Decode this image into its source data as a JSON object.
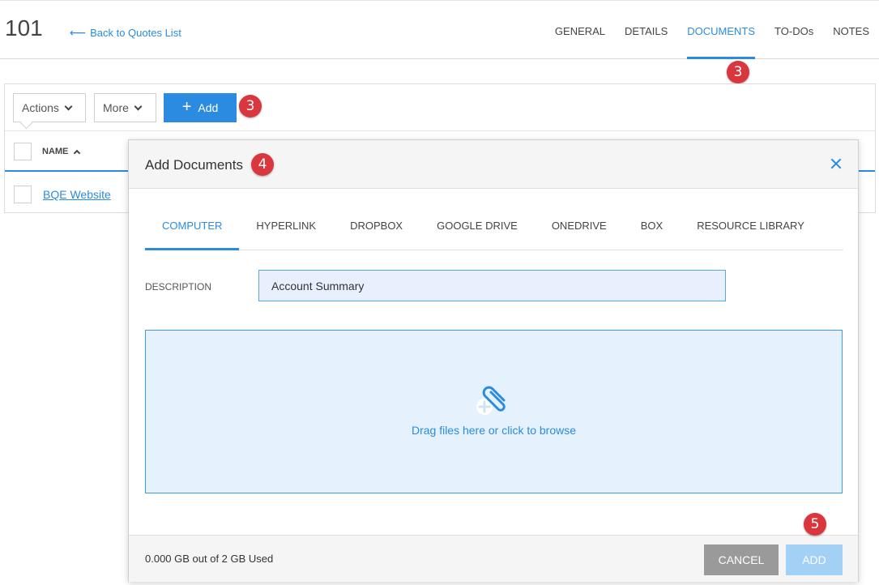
{
  "header": {
    "record_id": "101",
    "back_link": "Back to Quotes List",
    "tabs": [
      {
        "label": "GENERAL",
        "active": false
      },
      {
        "label": "DETAILS",
        "active": false
      },
      {
        "label": "DOCUMENTS",
        "active": true
      },
      {
        "label": "TO-DOs",
        "active": false
      },
      {
        "label": "NOTES",
        "active": false
      }
    ]
  },
  "badges": {
    "documents_tab": "3",
    "add_button": "3",
    "modal_title": "4",
    "modal_add": "5"
  },
  "toolbar": {
    "actions_label": "Actions",
    "more_label": "More",
    "add_label": "Add"
  },
  "grid": {
    "column_name": "NAME",
    "rows": [
      {
        "name": "BQE Website"
      }
    ]
  },
  "modal": {
    "title": "Add Documents",
    "source_tabs": [
      {
        "label": "COMPUTER",
        "active": true
      },
      {
        "label": "HYPERLINK",
        "active": false
      },
      {
        "label": "DROPBOX",
        "active": false
      },
      {
        "label": "GOOGLE DRIVE",
        "active": false
      },
      {
        "label": "ONEDRIVE",
        "active": false
      },
      {
        "label": "BOX",
        "active": false
      },
      {
        "label": "RESOURCE LIBRARY",
        "active": false
      }
    ],
    "description_label": "DESCRIPTION",
    "description_value": "Account Summary",
    "dropzone_text": "Drag files here or click to browse",
    "storage_text": "0.000 GB out of 2 GB Used",
    "cancel_label": "CANCEL",
    "add_label": "ADD"
  },
  "icons": {
    "back": "arrow-left-icon",
    "close": "close-icon",
    "attach": "paperclip-plus-icon",
    "dropdown": "chevron-down-icon",
    "sort": "chevron-up-icon"
  },
  "colors": {
    "accent": "#2a8be0",
    "badge": "#d9363e",
    "dropzone_bg": "#e5f1fc",
    "cancel_bg": "#9a9a9a",
    "add_disabled_bg": "#a3d0f5"
  }
}
